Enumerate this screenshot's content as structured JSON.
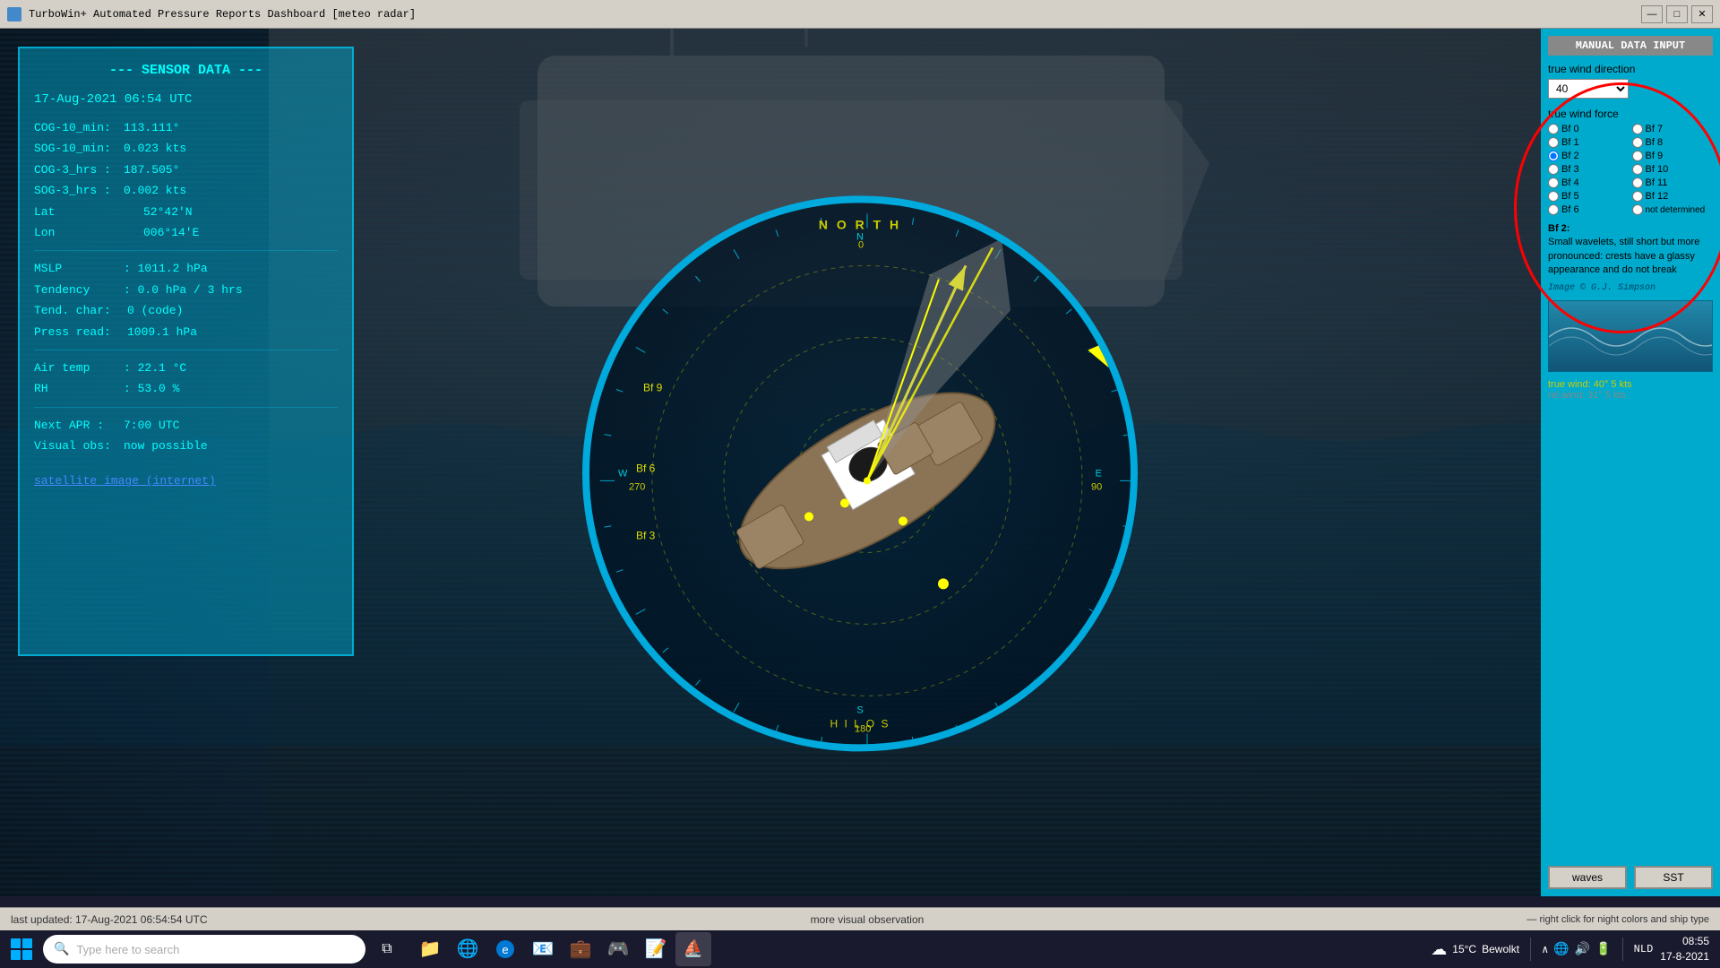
{
  "titlebar": {
    "title": "TurboWin+ Automated Pressure Reports Dashboard [meteo radar]",
    "minimize": "—",
    "maximize": "□",
    "close": "✕"
  },
  "sensor": {
    "header": "--- SENSOR DATA ---",
    "datetime": "17-Aug-2021  06:54 UTC",
    "cog_10_label": "COG-10_min:",
    "cog_10_value": "113.111°",
    "sog_10_label": "SOG-10_min:",
    "sog_10_value": "0.023 kts",
    "cog_3_label": "COG-3_hrs :",
    "cog_3_value": "187.505°",
    "sog_3_label": "SOG-3_hrs :",
    "sog_3_value": "0.002 kts",
    "lat_label": "Lat",
    "lat_value": "52°42'N",
    "lon_label": "Lon",
    "lon_value": "006°14'E",
    "mslp_label": "MSLP",
    "mslp_value": ": 1011.2 hPa",
    "tendency_label": "Tendency",
    "tendency_value": ": 0.0 hPa / 3 hrs",
    "tend_char_label": "Tend. char:",
    "tend_char_value": "0 (code)",
    "press_read_label": "Press read:",
    "press_read_value": "1009.1 hPa",
    "air_temp_label": "Air temp",
    "air_temp_value": ": 22.1 °C",
    "rh_label": "RH",
    "rh_value": ": 53.0 %",
    "next_apr_label": "Next APR :",
    "next_apr_value": "7:00 UTC",
    "visual_label": "Visual obs:",
    "visual_value": "now possible",
    "satellite_link": "satellite image (internet)"
  },
  "compass": {
    "north": "N O R T H",
    "south": "H I L O S",
    "bf_labels": [
      "Bf 9",
      "Bf 6",
      "Bf 3"
    ],
    "direction_marks": [
      "N",
      "E",
      "S",
      "W"
    ]
  },
  "manual_input": {
    "header": "MANUAL DATA INPUT",
    "wind_dir_label": "true wind direction",
    "wind_dir_value": "40",
    "wind_force_label": "true wind force",
    "bf_options": [
      {
        "label": "Bf 0",
        "value": "bf0",
        "checked": false
      },
      {
        "label": "Bf 7",
        "value": "bf7",
        "checked": false
      },
      {
        "label": "Bf 1",
        "value": "bf1",
        "checked": false
      },
      {
        "label": "Bf 8",
        "value": "bf8",
        "checked": false
      },
      {
        "label": "Bf 2",
        "value": "bf2",
        "checked": true
      },
      {
        "label": "Bf 9",
        "value": "bf9",
        "checked": false
      },
      {
        "label": "Bf 3",
        "value": "bf3",
        "checked": false
      },
      {
        "label": "Bf 10",
        "value": "bf10",
        "checked": false
      },
      {
        "label": "Bf 4",
        "value": "bf4",
        "checked": false
      },
      {
        "label": "Bf 11",
        "value": "bf11",
        "checked": false
      },
      {
        "label": "Bf 5",
        "value": "bf5",
        "checked": false
      },
      {
        "label": "Bf 12",
        "value": "bf12",
        "checked": false
      },
      {
        "label": "Bf 6",
        "value": "bf6",
        "checked": false
      },
      {
        "label": "not determined",
        "value": "notdet",
        "checked": false
      }
    ],
    "bf_desc_title": "Bf 2:",
    "bf_desc_text": "Small wavelets, still short but more pronounced: crests have a glassy appearance and do not break",
    "image_credit": "Image © G.J. Simpson",
    "true_wind": "true wind: 40° 5 kts",
    "rel_wind": "rel.wind: 31° 5 kts",
    "btn_waves": "waves",
    "btn_sst": "SST"
  },
  "status_bar": {
    "last_updated": "last updated:  17-Aug-2021 06:54:54 UTC",
    "center": "more visual observation",
    "right": "— right click for night colors and ship type"
  },
  "taskbar": {
    "search_placeholder": "Type here to search",
    "weather_temp": "15°C",
    "weather_desc": "Bewolkt",
    "time": "08:55",
    "date": "17-8-2021",
    "locale": "NLD"
  }
}
